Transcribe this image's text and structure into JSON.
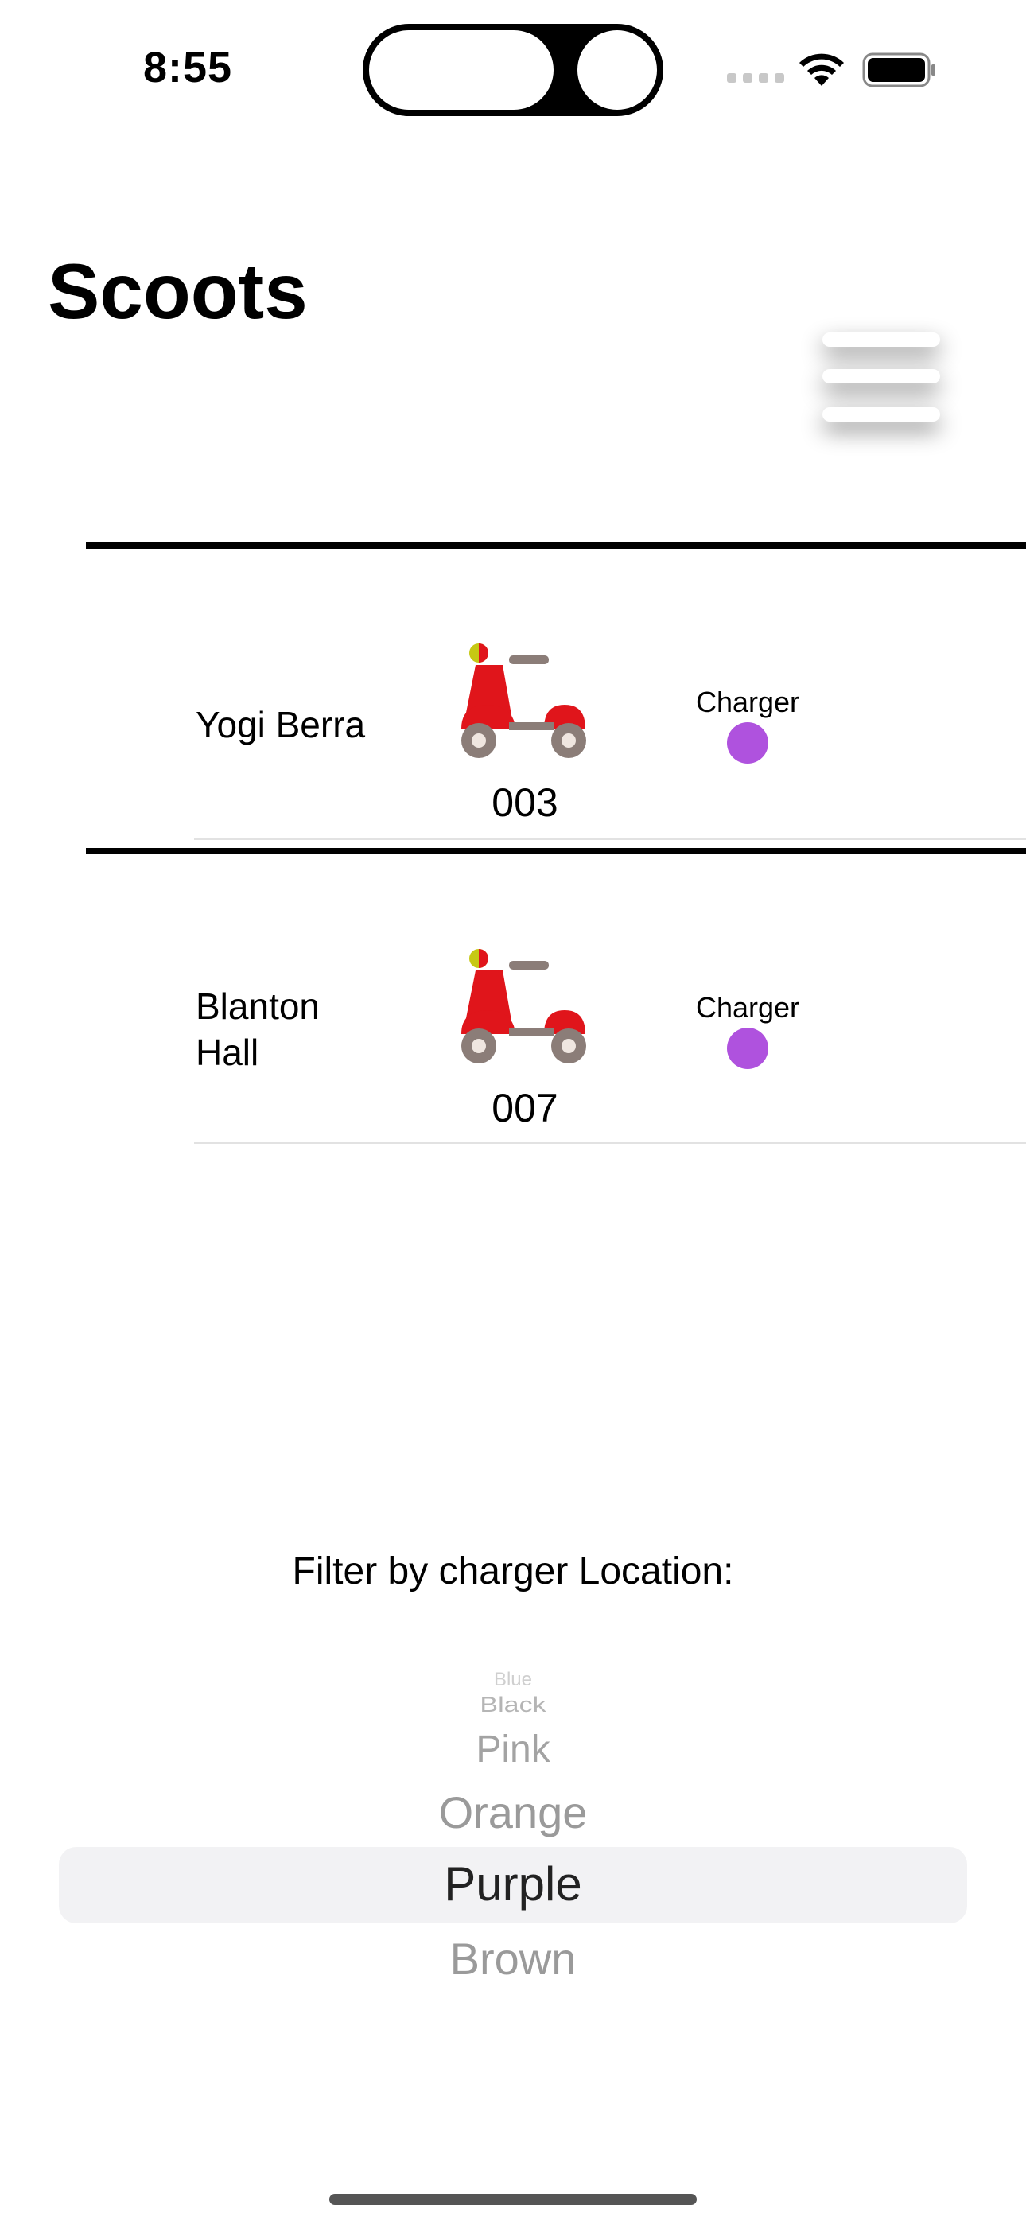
{
  "status_bar": {
    "time": "8:55",
    "icons": [
      "signal-icon",
      "wifi-icon",
      "battery-icon"
    ]
  },
  "header": {
    "title": "Scoots",
    "menu_icon": "hamburger-menu-icon"
  },
  "rows": [
    {
      "name": "Yogi Berra",
      "scooter_id": "003",
      "charger_label": "Charger",
      "charger_color": "#AF52DE",
      "icon": "scooter-icon"
    },
    {
      "name": "Blanton Hall",
      "scooter_id": "007",
      "charger_label": "Charger",
      "charger_color": "#AF52DE",
      "icon": "scooter-icon"
    }
  ],
  "filter": {
    "label": "Filter by charger Location:",
    "options": [
      "Blue",
      "Black",
      "Pink",
      "Orange",
      "Purple",
      "Brown"
    ],
    "selected": "Purple"
  }
}
